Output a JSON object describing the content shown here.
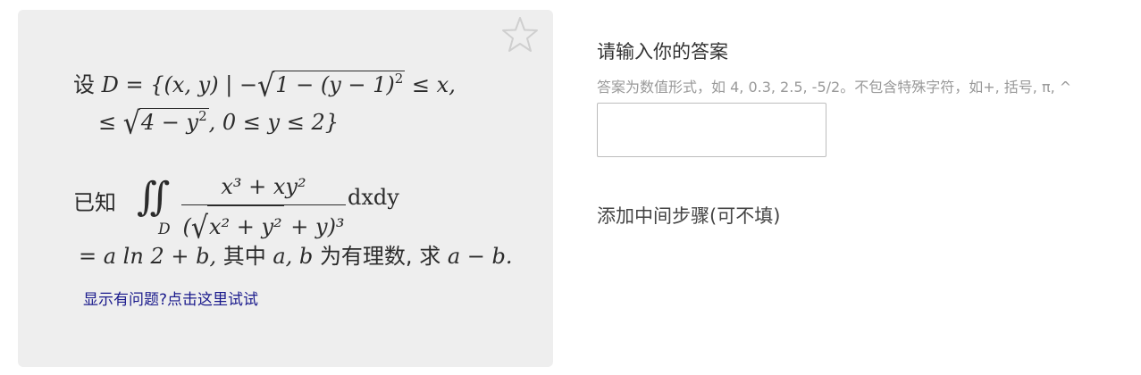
{
  "question": {
    "set_prefix": "设",
    "line1_expr_a": "D = {(x, y) | −",
    "line1_sqrt": "1 − (y − 1)",
    "line1_sqrt_exp": "2",
    "line1_expr_b": " ≤ x,",
    "line2_prefix": "≤ ",
    "line2_sqrt": "4 − y",
    "line2_sqrt_exp": "2",
    "line2_suffix": ", 0 ≤ y ≤ 2}",
    "known_prefix": "已知",
    "integral_symbol": "∬",
    "integral_region": "D",
    "fraction_numerator": "x³ + xy²",
    "fraction_den_open": "(",
    "fraction_den_sqrt": "x² + y²",
    "fraction_den_close": " + y)³",
    "differential": "dxdy",
    "result_expr": "= a ln 2 + b,",
    "result_cn1": "其中",
    "result_vars": "a, b",
    "result_cn2": "为有理数, 求",
    "result_target": "a − b."
  },
  "help_link": "显示有问题?点击这里试试",
  "answer": {
    "title": "请输入你的答案",
    "hint": "答案为数值形式，如 4, 0.3, 2.5, -5/2。不包含特殊字符，如+, 括号, π, ^",
    "input_value": "",
    "input_placeholder": "",
    "steps_label": "添加中间步骤(可不填)"
  },
  "icons": {
    "favorite": "star-icon"
  },
  "colors": {
    "card_bg": "#eeeeee",
    "link": "#1a1a8c",
    "hint": "#999999"
  }
}
